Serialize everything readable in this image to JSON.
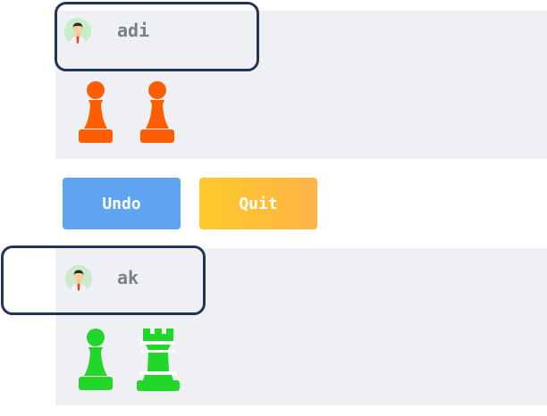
{
  "players": [
    {
      "name": "adi",
      "avatar_icon": "user-avatar-icon",
      "pieces": [
        {
          "type": "pawn",
          "icon": "pawn-icon",
          "color": "#ff5e00"
        },
        {
          "type": "pawn",
          "icon": "pawn-icon",
          "color": "#ff5e00"
        }
      ]
    },
    {
      "name": "ak",
      "avatar_icon": "user-avatar-icon",
      "pieces": [
        {
          "type": "pawn",
          "icon": "pawn-icon",
          "color": "#22d62a"
        },
        {
          "type": "rook",
          "icon": "rook-icon",
          "color": "#22d62a"
        }
      ]
    }
  ],
  "controls": {
    "undo_label": "Undo",
    "quit_label": "Quit"
  },
  "colors": {
    "panel_bg": "#eef0f4",
    "highlight_border": "#233557",
    "undo_button": "#5ea4f0",
    "quit_button": "#ffbf3a",
    "player1_pieces": "#ff5e00",
    "player2_pieces": "#22d62a"
  }
}
